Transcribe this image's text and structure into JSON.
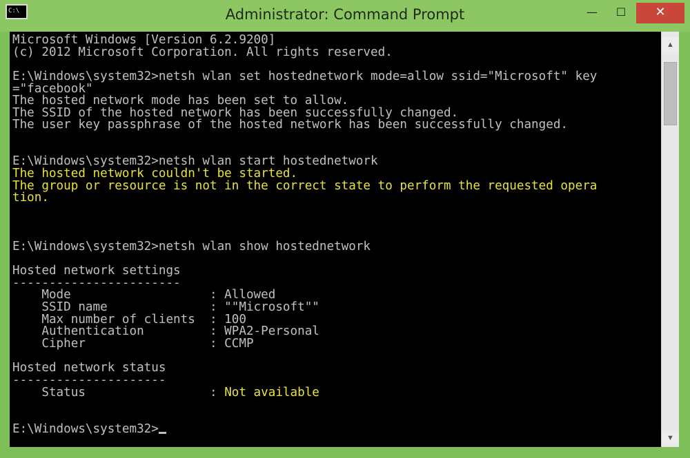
{
  "window": {
    "title": "Administrator: Command Prompt",
    "icon_label": "C:\\",
    "controls": {
      "minimize": "—",
      "maximize": "☐",
      "close": "✕"
    }
  },
  "console": {
    "lines": [
      {
        "text": "Microsoft Windows [Version 6.2.9200]",
        "color": "gray"
      },
      {
        "text": "(c) 2012 Microsoft Corporation. All rights reserved.",
        "color": "gray"
      },
      {
        "text": "",
        "color": "gray"
      },
      {
        "text": "E:\\Windows\\system32>netsh wlan set hostednetwork mode=allow ssid=\"Microsoft\" key",
        "color": "gray"
      },
      {
        "text": "=\"facebook\"",
        "color": "gray"
      },
      {
        "text": "The hosted network mode has been set to allow.",
        "color": "gray"
      },
      {
        "text": "The SSID of the hosted network has been successfully changed.",
        "color": "gray"
      },
      {
        "text": "The user key passphrase of the hosted network has been successfully changed.",
        "color": "gray"
      },
      {
        "text": "",
        "color": "gray"
      },
      {
        "text": "",
        "color": "gray"
      },
      {
        "text": "E:\\Windows\\system32>netsh wlan start hostednetwork",
        "color": "gray"
      },
      {
        "text": "The hosted network couldn't be started.",
        "color": "yellow"
      },
      {
        "text": "The group or resource is not in the correct state to perform the requested opera",
        "color": "yellow"
      },
      {
        "text": "tion.",
        "color": "yellow"
      },
      {
        "text": "",
        "color": "gray"
      },
      {
        "text": "",
        "color": "gray"
      },
      {
        "text": "",
        "color": "gray"
      },
      {
        "text": "E:\\Windows\\system32>netsh wlan show hostednetwork",
        "color": "gray"
      },
      {
        "text": "",
        "color": "gray"
      },
      {
        "text": "Hosted network settings",
        "color": "gray"
      },
      {
        "text": "-----------------------",
        "color": "gray"
      },
      {
        "text": "    Mode                   : Allowed",
        "color": "gray"
      },
      {
        "text": "    SSID name              : \"\"Microsoft\"\"",
        "color": "gray"
      },
      {
        "text": "    Max number of clients  : 100",
        "color": "gray"
      },
      {
        "text": "    Authentication         : WPA2-Personal",
        "color": "gray"
      },
      {
        "text": "    Cipher                 : CCMP",
        "color": "gray"
      },
      {
        "text": "",
        "color": "gray"
      },
      {
        "text": "Hosted network status",
        "color": "gray"
      },
      {
        "text": "---------------------",
        "color": "gray"
      },
      {
        "text": "    Status                 : ",
        "color": "gray",
        "suffix": "Not available",
        "suffix_color": "yellow"
      },
      {
        "text": "",
        "color": "gray"
      },
      {
        "text": "",
        "color": "gray"
      },
      {
        "text": "E:\\Windows\\system32>",
        "color": "gray",
        "cursor": true
      }
    ]
  },
  "colors": {
    "console_bg": "#000000",
    "console_text": "#c0c0c0",
    "console_yellow": "#e8e23a",
    "titlebar": "#8cc763",
    "close_button": "#c9463a"
  },
  "scrollbar": {
    "up_icon": "▲",
    "down_icon": "▼"
  }
}
